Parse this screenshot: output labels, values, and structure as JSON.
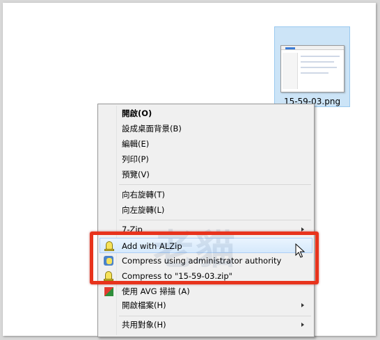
{
  "desktop": {
    "file": {
      "name": "15-59-03.png"
    }
  },
  "menu": {
    "items": [
      {
        "label": "開啟(O)",
        "bold": true
      },
      {
        "label": "設成桌面背景(B)"
      },
      {
        "label": "編輯(E)"
      },
      {
        "label": "列印(P)"
      },
      {
        "label": "預覽(V)"
      },
      {
        "label": "向右旋轉(T)"
      },
      {
        "label": "向左旋轉(L)"
      },
      {
        "label": "7-Zip",
        "submenu": true
      },
      {
        "label": "Add with ALZip",
        "icon": "alzip-icon",
        "highlighted": true
      },
      {
        "label": "Compress using administrator authority",
        "icon": "alzip-admin-icon"
      },
      {
        "label": "Compress to \"15-59-03.zip\"",
        "icon": "alzip-icon"
      },
      {
        "label": "使用 AVG 掃描 (A)",
        "icon": "avg-icon"
      },
      {
        "label": "開啟檔案(H)",
        "submenu": true
      },
      {
        "label": "共用對象(H)",
        "submenu": true
      }
    ]
  },
  "watermark": {
    "text": "老貓"
  },
  "colors": {
    "highlight_box": "#e8331c",
    "menu_background": "#f0f0f0",
    "hover_fill": "#d6e9fc",
    "file_selection": "#cce4f7"
  }
}
